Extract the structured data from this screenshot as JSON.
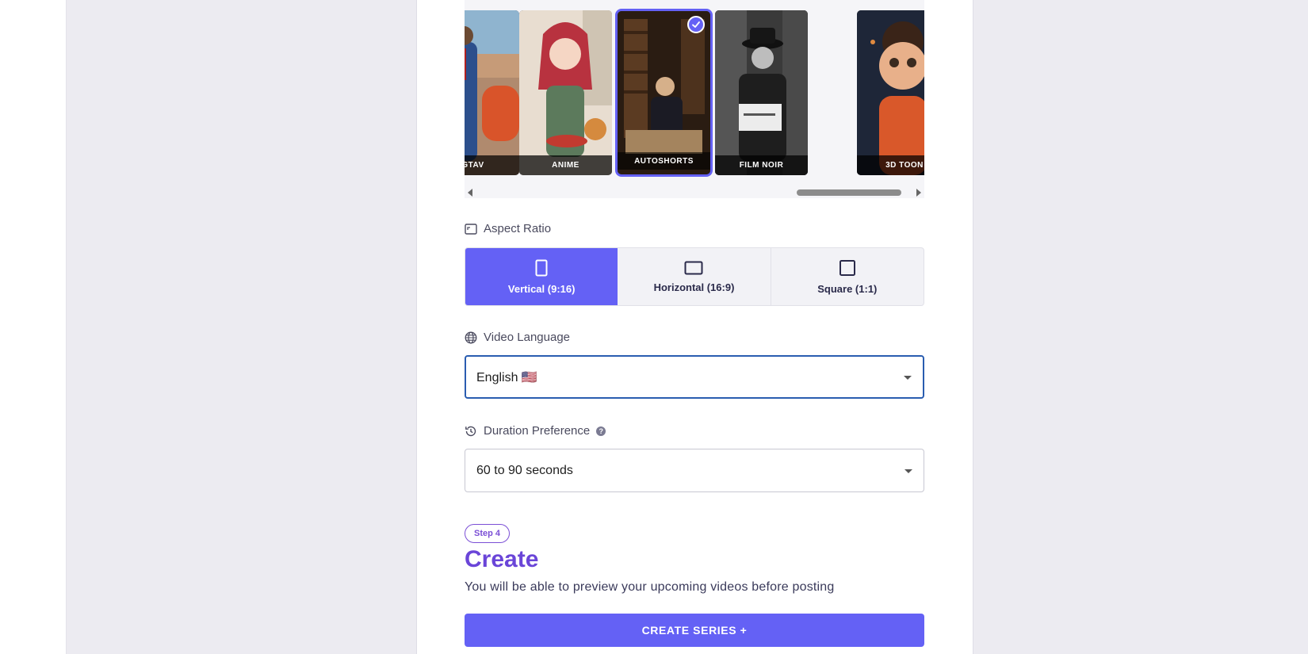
{
  "styles": {
    "cards": [
      {
        "label": "GTAV"
      },
      {
        "label": "ANIME"
      },
      {
        "label": "AUTOSHORTS",
        "selected": true
      },
      {
        "label": "FILM NOIR"
      },
      {
        "label": "3D TOON"
      }
    ]
  },
  "aspect_ratio": {
    "label": "Aspect Ratio",
    "options": [
      {
        "label": "Vertical (9:16)",
        "active": true
      },
      {
        "label": "Horizontal (16:9)",
        "active": false
      },
      {
        "label": "Square (1:1)",
        "active": false
      }
    ]
  },
  "video_language": {
    "label": "Video Language",
    "value": "English 🇺🇸"
  },
  "duration": {
    "label": "Duration Preference",
    "help": "?",
    "value": "60 to 90 seconds"
  },
  "step4": {
    "badge": "Step 4",
    "title": "Create",
    "subtitle": "You will be able to preview your upcoming videos before posting",
    "button": "CREATE SERIES +"
  },
  "colors": {
    "accent": "#6461f5",
    "title_purple": "#6a45d8",
    "panel_bg": "#ecebf1"
  }
}
